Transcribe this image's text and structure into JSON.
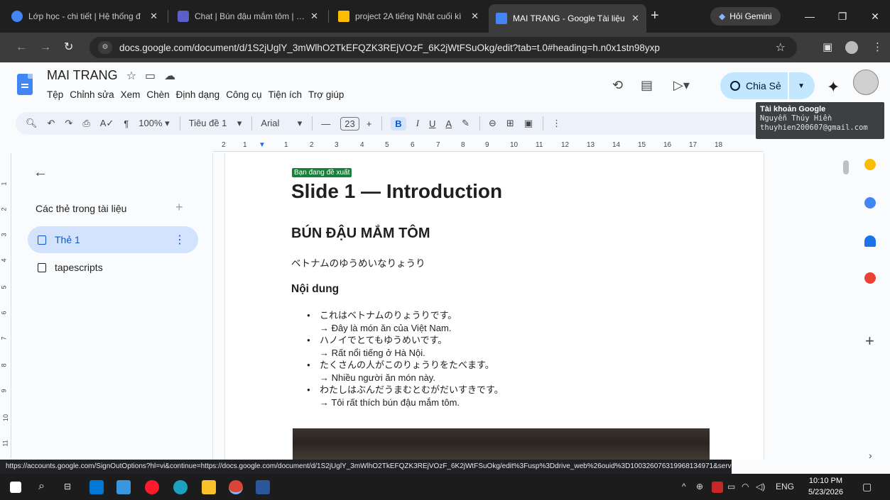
{
  "browser": {
    "tabs": [
      {
        "title": "Lớp học - chi tiết | Hệ thống đ",
        "favicon_color": "#4285f4"
      },
      {
        "title": "Chat | Bún đậu mắm tôm | Mi",
        "favicon_color": "#5b5fc7"
      },
      {
        "title": "project 2A tiếng Nhật cuối kì",
        "favicon_color": "#fbbc04"
      },
      {
        "title": "MAI TRANG - Google Tài liệu",
        "favicon_color": "#4285f4"
      }
    ],
    "gemini_label": "Hỏi Gemini",
    "url": "docs.google.com/document/d/1S2jUglY_3mWlhO2TkEFQZK3REjVOzF_6K2jWtFSuOkg/edit?tab=t.0#heading=h.n0x1stn98yxp"
  },
  "docs": {
    "title": "MAI TRANG",
    "menu": [
      "Tệp",
      "Chỉnh sửa",
      "Xem",
      "Chèn",
      "Định dạng",
      "Công cụ",
      "Tiện ích",
      "Trợ giúp"
    ],
    "share_label": "Chia Sẻ",
    "account_tip": {
      "heading": "Tài khoản Google",
      "name": "Nguyễn Thúy Hiền",
      "email": "thuyhien200607@gmail.com"
    },
    "toolbar": {
      "zoom": "100%",
      "style": "Tiêu đề 1",
      "font": "Arial",
      "size": "23"
    },
    "ruler": [
      "2",
      "1",
      "1",
      "2",
      "3",
      "4",
      "5",
      "6",
      "7",
      "8",
      "9",
      "10",
      "11",
      "12",
      "13",
      "14",
      "15",
      "16",
      "17",
      "18"
    ],
    "vruler": [
      "1",
      "2",
      "3",
      "4",
      "5",
      "6",
      "7",
      "8",
      "9",
      "10",
      "11"
    ]
  },
  "sidebar": {
    "title": "Các thẻ trong tài liệu",
    "items": [
      {
        "label": "Thẻ 1",
        "selected": true
      },
      {
        "label": "tapescripts",
        "selected": false
      }
    ]
  },
  "document": {
    "suggest_badge": "Bạn đang đề xuất",
    "heading1": "Slide 1 — Introduction",
    "heading2": "BÚN ĐẬU MẮM TÔM",
    "subtitle_jp": "ベトナムのゆうめいなりょうり",
    "section": "Nội dung",
    "bullets": [
      {
        "jp": "これはベトナムのりょうりです。",
        "vi": "→ Đây là món ăn của Việt Nam."
      },
      {
        "jp": "ハノイでとてもゆうめいです。",
        "vi": "→ Rất nổi tiếng ở Hà Nội."
      },
      {
        "jp": "たくさんの人がこのりょうりをたべます。",
        "vi": "→ Nhiều người ăn món này."
      },
      {
        "jp": "わたしはぶんだうまむとむがだいすきです。",
        "vi": "→ Tôi rất thích bún đậu mắm tôm."
      }
    ]
  },
  "status_url": "https://accounts.google.com/SignOutOptions?hl=vi&continue=https://docs.google.com/document/d/1S2jUglY_3mWlhO2TkEFQZK3REjVOzF_6K2jWtFSuOkg/edit%3Fusp%3Ddrive_web%26ouid%3D100326076319968134971&service...",
  "taskbar": {
    "lang": "ENG",
    "time": "10:10 PM",
    "date": "5/23/2026"
  }
}
